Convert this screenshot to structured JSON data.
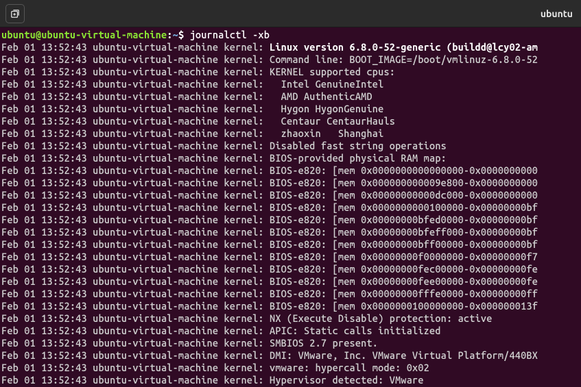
{
  "titlebar": {
    "title": "ubuntu"
  },
  "prompt": {
    "user_host": "ubuntu@ubuntu-virtual-machine",
    "colon": ":",
    "path": "~",
    "dollar": "$ ",
    "command": "journalctl -xb"
  },
  "log_prefix": "Feb 01 13:52:43 ubuntu-virtual-machine kernel: ",
  "lines": [
    {
      "bold": true,
      "text": "Linux version 6.8.0-52-generic (buildd@lcy02-am"
    },
    {
      "bold": false,
      "text": "Command line: BOOT_IMAGE=/boot/vmlinuz-6.8.0-52"
    },
    {
      "bold": false,
      "text": "KERNEL supported cpus:"
    },
    {
      "bold": false,
      "text": "  Intel GenuineIntel"
    },
    {
      "bold": false,
      "text": "  AMD AuthenticAMD"
    },
    {
      "bold": false,
      "text": "  Hygon HygonGenuine"
    },
    {
      "bold": false,
      "text": "  Centaur CentaurHauls"
    },
    {
      "bold": false,
      "text": "  zhaoxin   Shanghai"
    },
    {
      "bold": false,
      "text": "Disabled fast string operations"
    },
    {
      "bold": false,
      "text": "BIOS-provided physical RAM map:"
    },
    {
      "bold": false,
      "text": "BIOS-e820: [mem 0x0000000000000000-0x0000000000"
    },
    {
      "bold": false,
      "text": "BIOS-e820: [mem 0x000000000009e800-0x0000000000"
    },
    {
      "bold": false,
      "text": "BIOS-e820: [mem 0x00000000000dc000-0x0000000000"
    },
    {
      "bold": false,
      "text": "BIOS-e820: [mem 0x0000000000100000-0x00000000bf"
    },
    {
      "bold": false,
      "text": "BIOS-e820: [mem 0x00000000bfed0000-0x00000000bf"
    },
    {
      "bold": false,
      "text": "BIOS-e820: [mem 0x00000000bfeff000-0x00000000bf"
    },
    {
      "bold": false,
      "text": "BIOS-e820: [mem 0x00000000bff00000-0x00000000bf"
    },
    {
      "bold": false,
      "text": "BIOS-e820: [mem 0x00000000f0000000-0x00000000f7"
    },
    {
      "bold": false,
      "text": "BIOS-e820: [mem 0x00000000fec00000-0x00000000fe"
    },
    {
      "bold": false,
      "text": "BIOS-e820: [mem 0x00000000fee00000-0x00000000fe"
    },
    {
      "bold": false,
      "text": "BIOS-e820: [mem 0x00000000fffe0000-0x00000000ff"
    },
    {
      "bold": false,
      "text": "BIOS-e820: [mem 0x0000000100000000-0x000000013f"
    },
    {
      "bold": false,
      "text": "NX (Execute Disable) protection: active"
    },
    {
      "bold": false,
      "text": "APIC: Static calls initialized"
    },
    {
      "bold": false,
      "text": "SMBIOS 2.7 present."
    },
    {
      "bold": false,
      "text": "DMI: VMware, Inc. VMware Virtual Platform/440BX"
    },
    {
      "bold": false,
      "text": "vmware: hypercall mode: 0x02"
    },
    {
      "bold": false,
      "text": "Hypervisor detected: VMware"
    }
  ]
}
